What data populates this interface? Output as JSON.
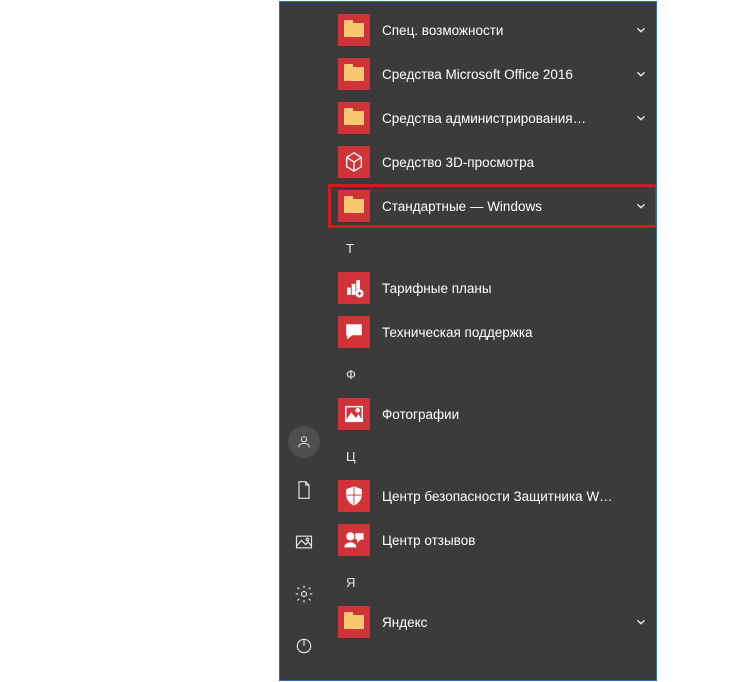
{
  "accent_color": "#d13438",
  "highlight_color": "#cf1d1d",
  "rail": {
    "user": "user-account",
    "documents": "documents",
    "pictures": "pictures",
    "settings": "settings",
    "power": "power"
  },
  "groups": [
    {
      "letter": null,
      "items": [
        {
          "icon": "folder",
          "label": "Спец. возможности",
          "expandable": true,
          "highlighted": false
        },
        {
          "icon": "folder",
          "label": "Средства Microsoft Office 2016",
          "expandable": true,
          "highlighted": false
        },
        {
          "icon": "folder",
          "label": "Средства администрирования…",
          "expandable": true,
          "highlighted": false
        },
        {
          "icon": "3dviewer",
          "label": "Средство 3D-просмотра",
          "expandable": false,
          "highlighted": false
        },
        {
          "icon": "folder",
          "label": "Стандартные — Windows",
          "expandable": true,
          "highlighted": true
        }
      ]
    },
    {
      "letter": "Т",
      "items": [
        {
          "icon": "plans",
          "label": "Тарифные планы",
          "expandable": false,
          "highlighted": false
        },
        {
          "icon": "support",
          "label": "Техническая поддержка",
          "expandable": false,
          "highlighted": false
        }
      ]
    },
    {
      "letter": "Ф",
      "items": [
        {
          "icon": "photos",
          "label": "Фотографии",
          "expandable": false,
          "highlighted": false
        }
      ]
    },
    {
      "letter": "Ц",
      "items": [
        {
          "icon": "defender",
          "label": "Центр безопасности Защитника W…",
          "expandable": false,
          "highlighted": false
        },
        {
          "icon": "feedback",
          "label": "Центр отзывов",
          "expandable": false,
          "highlighted": false
        }
      ]
    },
    {
      "letter": "Я",
      "items": [
        {
          "icon": "folder",
          "label": "Яндекс",
          "expandable": true,
          "highlighted": false
        }
      ]
    }
  ]
}
